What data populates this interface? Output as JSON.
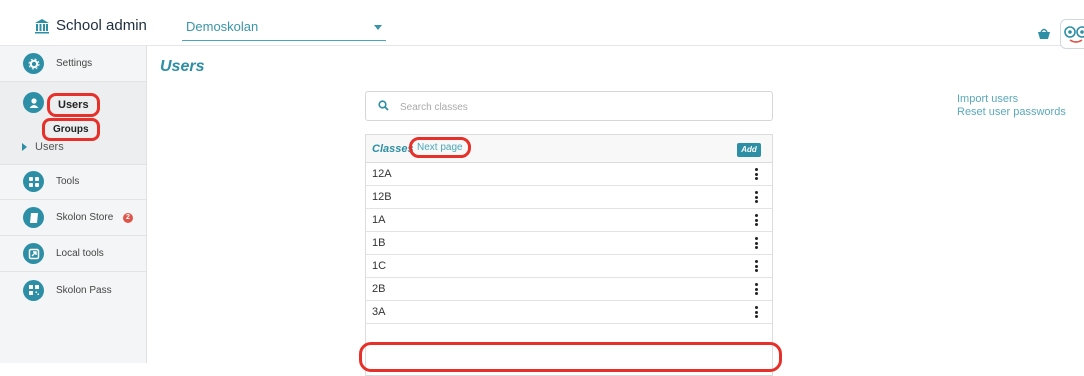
{
  "header": {
    "brand_label": "School admin",
    "school_select": "Demoskolan"
  },
  "sidebar": {
    "items": [
      {
        "label": "Settings",
        "icon": "gear-icon"
      },
      {
        "label": "Users",
        "icon": "user-icon"
      },
      {
        "label": "Groups"
      },
      {
        "label": "Users"
      },
      {
        "label": "Tools",
        "icon": "grid-icon"
      },
      {
        "label": "Skolon Store",
        "icon": "book-icon",
        "badge": "2"
      },
      {
        "label": "Local tools",
        "icon": "external-link-icon"
      },
      {
        "label": "Skolon Pass",
        "icon": "qr-icon"
      }
    ]
  },
  "main": {
    "title": "Users",
    "search_placeholder": "Search classes",
    "links": [
      "Import users",
      "Reset user passwords"
    ],
    "classes": {
      "title": "Classes",
      "next_page": "Next page",
      "add": "Add",
      "rows": [
        "12A",
        "12B",
        "1A",
        "1B",
        "1C",
        "2B",
        "3A"
      ]
    }
  },
  "colors": {
    "accent": "#2d8fa6",
    "highlight": "#e8302a",
    "badge": "#e0554a"
  }
}
